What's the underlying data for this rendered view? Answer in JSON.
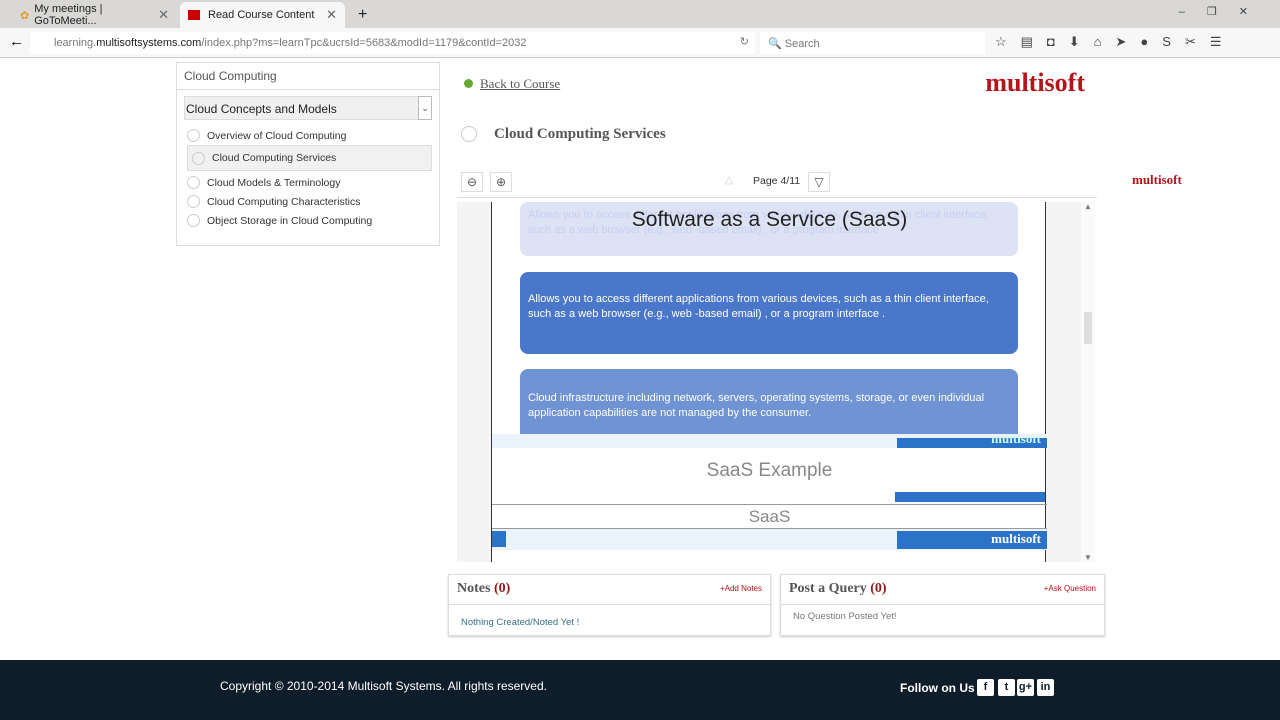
{
  "browser": {
    "tabs": [
      {
        "label": "My meetings | GoToMeeti...",
        "icon": "gotomeeting-icon"
      },
      {
        "label": "Read Course Content",
        "icon": "multisoft-favicon"
      }
    ],
    "url_host": "learning.",
    "url_domain": "multisoftsystems.com",
    "url_path": "/index.php?ms=learnTpc&ucrsId=5683&modId=1179&contId=2032",
    "search_placeholder": "Search"
  },
  "sidebar": {
    "course": "Cloud Computing",
    "module": "Cloud Concepts and Models",
    "items": [
      {
        "label": "Overview of Cloud Computing"
      },
      {
        "label": "Cloud Computing Services",
        "active": true
      },
      {
        "label": "Cloud Models & Terminology"
      },
      {
        "label": "Cloud Computing Characteristics"
      },
      {
        "label": "Object Storage in Cloud Computing"
      }
    ]
  },
  "main": {
    "back": "Back to Course",
    "logo": "multisoft",
    "content_title": "Cloud Computing Services",
    "page_indicator": "Page 4/11",
    "slide": {
      "title": "Software as a Service (SaaS)",
      "text1": "Allows you to access different applications from various devices, such as a thin client interface, such as a web browser (e.g., web -based email) , or a program interface .",
      "text2": "Cloud infrastructure including network, servers, operating systems, storage, or even individual application capabilities are not managed by the consumer.",
      "logo": "multisoft",
      "next_title": "SaaS Example",
      "next_label": "SaaS"
    }
  },
  "notes": {
    "title": "Notes",
    "count": "(0)",
    "action": "+Add Notes",
    "empty": "Nothing Created/Noted Yet !"
  },
  "query": {
    "title": "Post a Query",
    "count": "(0)",
    "action": "+Ask Question",
    "empty": "No Question Posted Yet!"
  },
  "side_logo": "multisoft",
  "footer": {
    "copyright": "Copyright © 2010-2014 Multisoft Systems. All rights reserved.",
    "follow": "Follow on Us",
    "social": [
      "f",
      "t",
      "g+",
      "in"
    ]
  },
  "colors": {
    "brand": "#b5141a",
    "slide_box": "#4a77c9",
    "footer": "#0f1d2a"
  }
}
